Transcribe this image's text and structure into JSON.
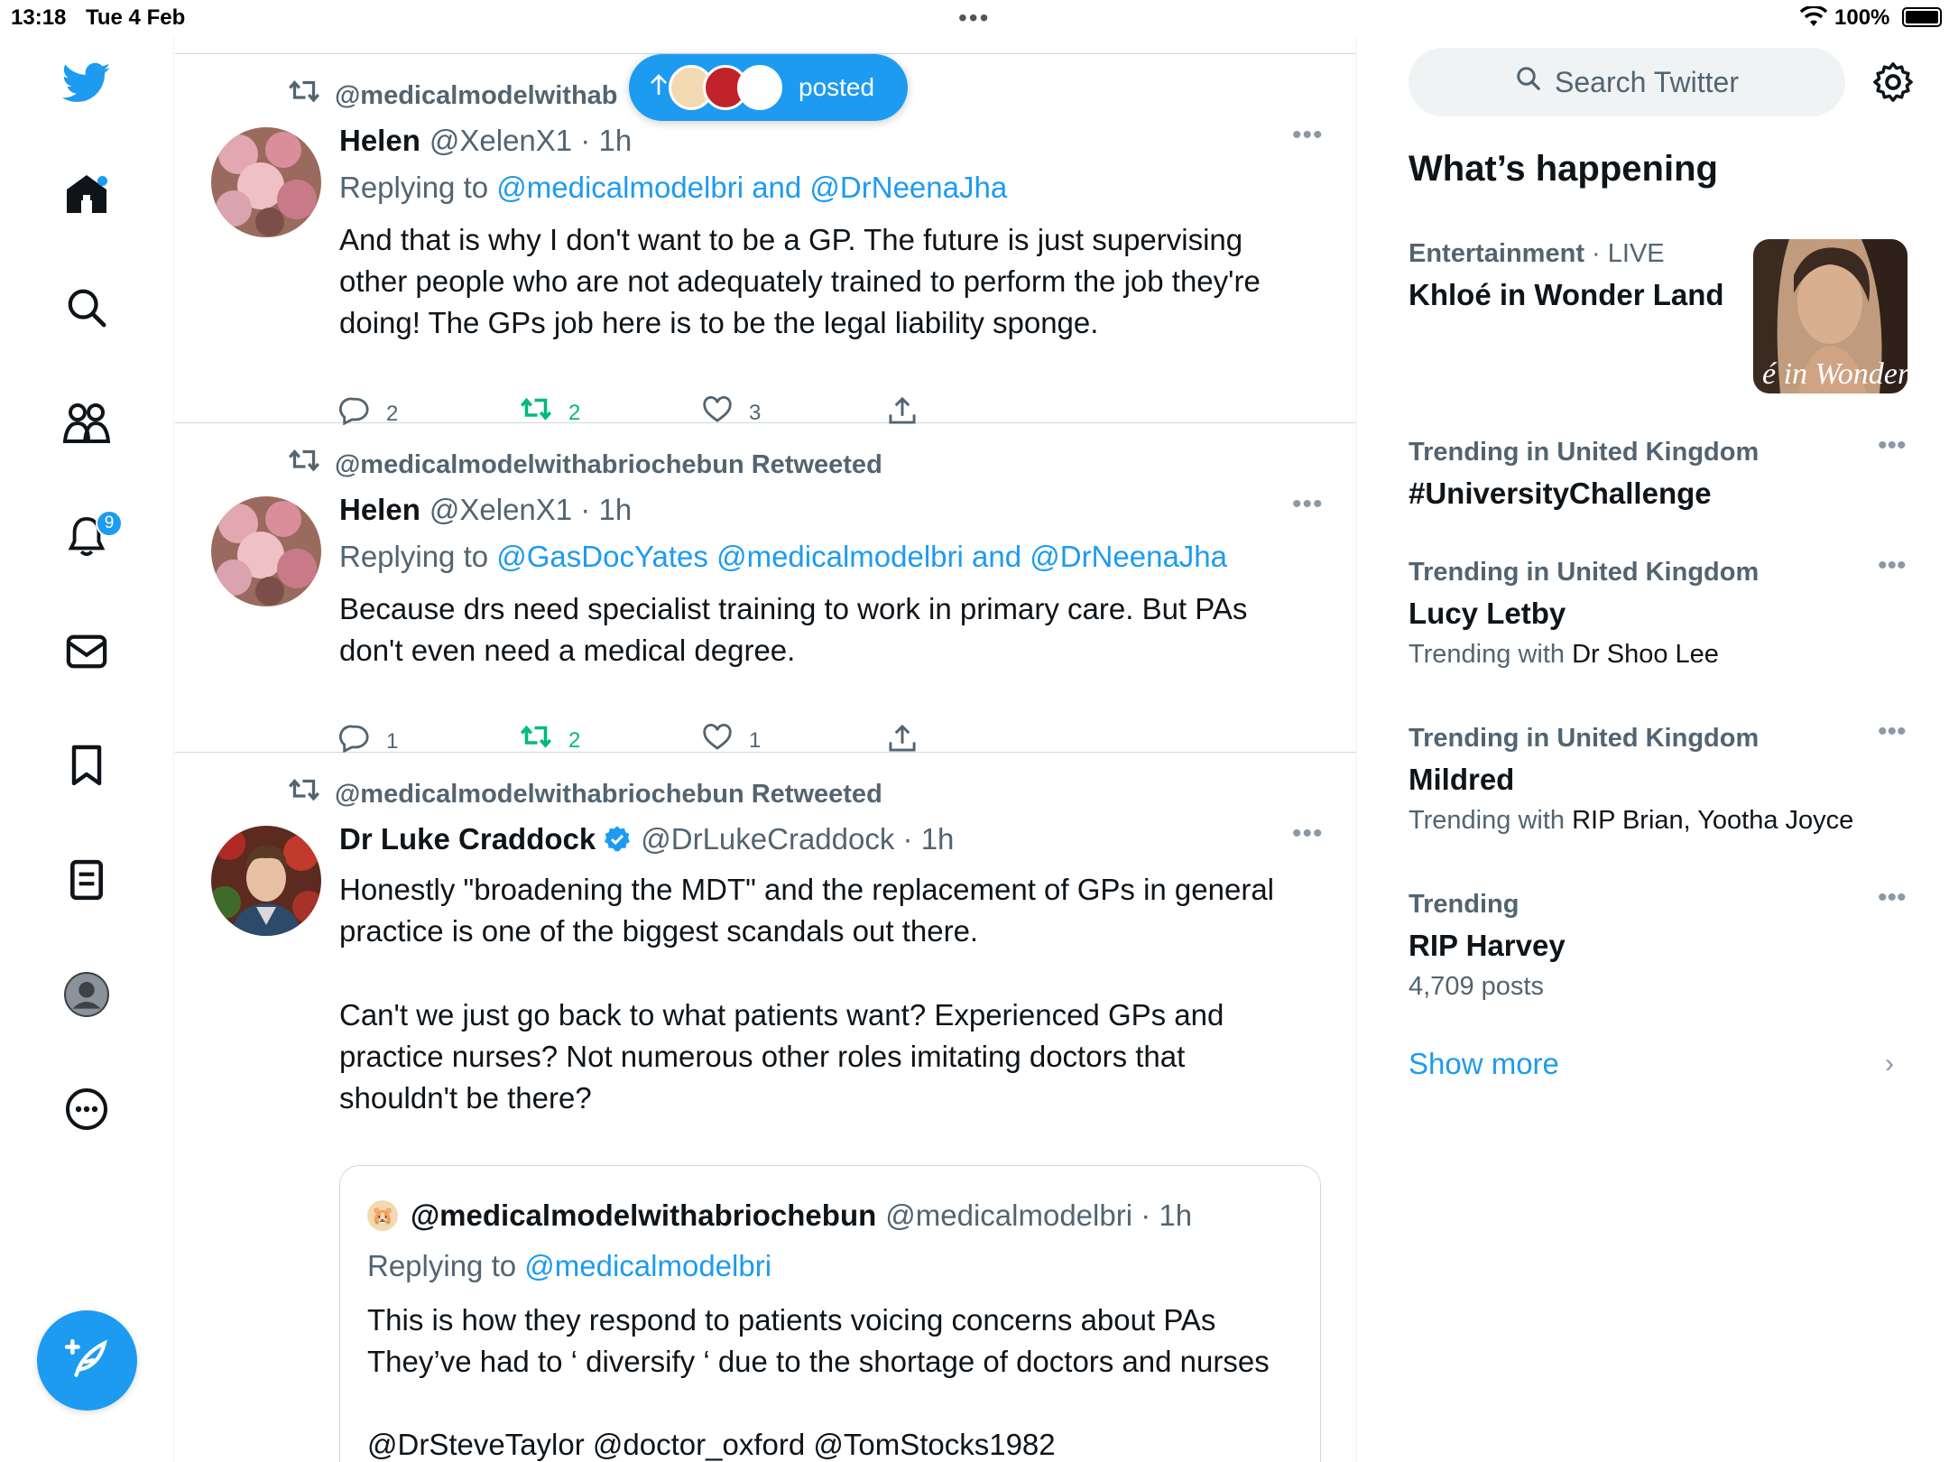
{
  "status": {
    "time": "13:18",
    "date": "Tue 4 Feb",
    "battery": "100%"
  },
  "nav": {
    "notifications_badge": "9",
    "accent": "#1d9bf0"
  },
  "pill": {
    "text": "posted"
  },
  "tweets": [
    {
      "retweet_line": "@medicalmodelwithab",
      "name": "Helen",
      "handle": "@XelenX1 · 1h",
      "reply_prefix": "Replying to ",
      "reply_to": "@medicalmodelbri and @DrNeenaJha",
      "text": "And that is why I don't want to be a GP. The future is just supervising other people who are not adequately trained to perform the job they're doing! The GPs job here is to be the legal liability sponge.",
      "replies": "2",
      "retweets": "2",
      "likes": "3"
    },
    {
      "retweet_line": "@medicalmodelwithabriochebun Retweeted",
      "name": "Helen",
      "handle": "@XelenX1 · 1h",
      "reply_prefix": "Replying to ",
      "reply_to": "@GasDocYates @medicalmodelbri and @DrNeenaJha",
      "text": "Because drs need specialist training to work in primary care. But PAs don't even need a medical degree.",
      "replies": "1",
      "retweets": "2",
      "likes": "1"
    },
    {
      "retweet_line": "@medicalmodelwithabriochebun Retweeted",
      "name": "Dr Luke Craddock",
      "handle": "@DrLukeCraddock · 1h",
      "text_p1": "Honestly \"broadening the MDT\" and the replacement of GPs in general practice is one of the biggest scandals out there.",
      "text_p2": "Can't we just go back to what patients want? Experienced GPs and practice nurses? Not numerous other roles imitating doctors that shouldn't be there?",
      "quote": {
        "name": "@medicalmodelwithabriochebun",
        "handle": "@medicalmodelbri · 1h",
        "reply_prefix": "Replying to ",
        "reply_to": "@medicalmodelbri",
        "text_l1": "This is how they respond to patients voicing concerns about PAs",
        "text_l2": "They’ve had to ‘ diversify ‘ due to the shortage of doctors and nurses",
        "text_l3": "@DrSteveTaylor @doctor_oxford @TomStocks1982"
      }
    }
  ],
  "sidebar": {
    "search_placeholder": "Search Twitter",
    "title": "What’s happening",
    "trends": [
      {
        "category": "Entertainment",
        "live": " · LIVE",
        "name": "Khloé in Wonder Land",
        "image_text": "é in Wonder l"
      },
      {
        "category": "Trending in United Kingdom",
        "name": "#UniversityChallenge"
      },
      {
        "category": "Trending in United Kingdom",
        "name": "Lucy Letby",
        "sub_prefix": "Trending with ",
        "sub": "Dr Shoo Lee"
      },
      {
        "category": "Trending in United Kingdom",
        "name": "Mildred",
        "sub_prefix": "Trending with ",
        "sub": "RIP Brian, Yootha Joyce"
      },
      {
        "category": "Trending",
        "name": "RIP Harvey",
        "sub_plain": "4,709 posts"
      }
    ],
    "show_more": "Show more"
  }
}
